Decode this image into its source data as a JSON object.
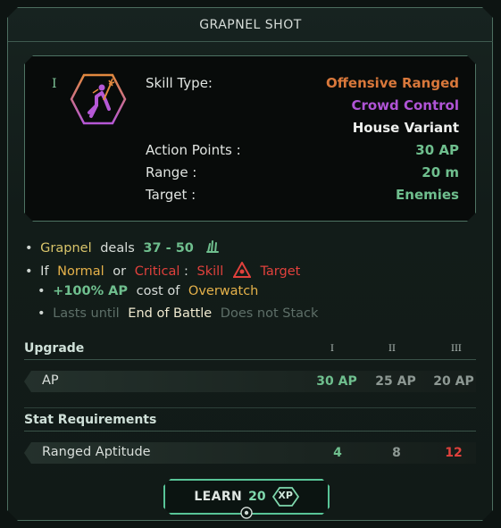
{
  "title": "GRAPNEL SHOT",
  "tier_marker": "I",
  "icon": "grapnel-shot-skill-icon",
  "info": {
    "skill_type_label": "Skill Type:",
    "skill_type_values": [
      "Offensive Ranged",
      "Crowd Control",
      "House Variant"
    ],
    "action_points_label": "Action Points :",
    "action_points_value": "30 AP",
    "range_label": "Range :",
    "range_value": "20 m",
    "target_label": "Target :",
    "target_value": "Enemies"
  },
  "description": {
    "line1": {
      "bullet": "•",
      "a": "Grapnel",
      "b": "deals",
      "c": "37 - 50",
      "icon": "damage-claw-icon"
    },
    "line2": {
      "bullet": "•",
      "a": "If",
      "b": "Normal",
      "c": "or",
      "d": "Critical",
      "e": ":",
      "f": "Skill",
      "icon": "warning-triangle-icon",
      "g": "Target"
    },
    "line3": {
      "bullet": "•",
      "a": "+100% AP",
      "b": "cost of",
      "c": "Overwatch"
    },
    "line4": {
      "bullet": "•",
      "a": "Lasts until",
      "b": "End of Battle",
      "c": "Does not Stack"
    }
  },
  "upgrade": {
    "header": "Upgrade",
    "tiers": [
      "I",
      "II",
      "III"
    ],
    "row_label": "AP",
    "values": [
      "30 AP",
      "25 AP",
      "20 AP"
    ]
  },
  "stat_requirements": {
    "header": "Stat Requirements",
    "row_label": "Ranged Aptitude",
    "values": [
      "4",
      "8",
      "12"
    ]
  },
  "learn": {
    "label": "LEARN",
    "cost": "20",
    "currency": "XP"
  },
  "colors": {
    "offensive": "#d9783b",
    "crowd_control": "#b054d6",
    "positive": "#6fbf8e",
    "negative": "#e0413c",
    "accent": "#58c497"
  }
}
